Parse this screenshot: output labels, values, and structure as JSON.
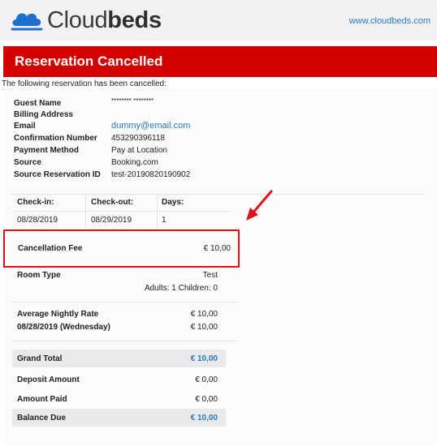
{
  "header": {
    "logo_text_light": "Cloud",
    "logo_text_bold": "beds",
    "site_link": "www.cloudbeds.com"
  },
  "banner": {
    "title": "Reservation Cancelled"
  },
  "subnote": "The following reservation has been cancelled:",
  "guest_info": [
    {
      "label": "Guest Name",
      "value": "******** ********"
    },
    {
      "label": "Billing Address",
      "value": ""
    },
    {
      "label": "Email",
      "value": "dummy@email.com"
    },
    {
      "label": "Confirmation Number",
      "value": "453290396118"
    },
    {
      "label": "Payment Method",
      "value": "Pay at Location"
    },
    {
      "label": "Source",
      "value": "Booking.com"
    },
    {
      "label": "Source Reservation ID",
      "value": "test-20190820190902"
    }
  ],
  "stay": {
    "checkin_label": "Check-in:",
    "checkout_label": "Check-out:",
    "days_label": "Days:",
    "checkin": "08/28/2019",
    "checkout": "08/29/2019",
    "days": "1"
  },
  "cancellation": {
    "label": "Cancellation Fee",
    "value": "€ 10,00"
  },
  "room": {
    "label": "Room Type",
    "value": "Test",
    "occupancy": "Adults: 1 Children: 0"
  },
  "rates": {
    "avg_label": "Average Nightly Rate",
    "avg_value": "€ 10,00",
    "date_label": "08/28/2019 (Wednesday)",
    "date_value": "€ 10,00"
  },
  "totals": {
    "grand_total_label": "Grand Total",
    "grand_total_value": "€ 10,00",
    "deposit_label": "Deposit Amount",
    "deposit_value": "€ 0,00",
    "paid_label": "Amount Paid",
    "paid_value": "€ 0,00",
    "balance_label": "Balance Due",
    "balance_value": "€ 10,00"
  },
  "colors": {
    "brand_red": "#d40000",
    "link_blue": "#2a79c0",
    "logo_blue": "#1e6fd0",
    "callout_red": "#d9141a"
  },
  "icons": [
    "cloudbeds-logo-icon",
    "red-arrow-icon"
  ]
}
